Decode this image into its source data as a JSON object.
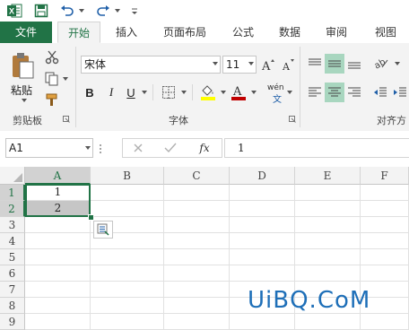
{
  "colors": {
    "accent": "#217346",
    "ribbon_bg": "#f3f3f3",
    "selection_fill": "#c6c6c6",
    "font_color_bar": "#c00000",
    "fill_color_bar": "#ffff00"
  },
  "qat": {
    "icons": [
      "excel-logo-icon",
      "save-icon",
      "undo-icon",
      "redo-icon",
      "customize-icon"
    ],
    "logo_letter": "X"
  },
  "tabs": [
    {
      "label": "文件"
    },
    {
      "label": "开始"
    },
    {
      "label": "插入"
    },
    {
      "label": "页面布局"
    },
    {
      "label": "公式"
    },
    {
      "label": "数据"
    },
    {
      "label": "审阅"
    },
    {
      "label": "视图"
    }
  ],
  "ribbon": {
    "clipboard": {
      "label": "剪贴板",
      "paste_label": "粘贴"
    },
    "font": {
      "label": "字体",
      "family": "宋体",
      "size": "11",
      "bold": "B",
      "italic": "I",
      "underline": "U",
      "phonetic": "wén"
    },
    "alignment": {
      "label": "对齐方"
    }
  },
  "formula_bar": {
    "name_box": "A1",
    "fx": "fx",
    "value": "1"
  },
  "sheet": {
    "columns": [
      "A",
      "B",
      "C",
      "D",
      "E",
      "F"
    ],
    "rows": [
      "1",
      "2",
      "3",
      "4",
      "5",
      "6",
      "7",
      "8",
      "9"
    ],
    "cells": {
      "A1": "1",
      "A2": "2"
    }
  },
  "watermark": "UiBQ.CoM"
}
